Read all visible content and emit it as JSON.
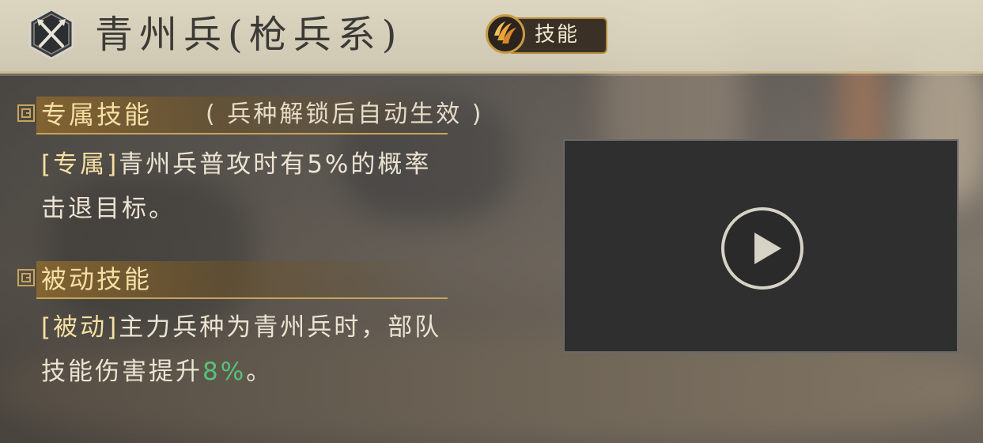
{
  "header": {
    "title": "青州兵(枪兵系)",
    "skill_tag_label": "技能",
    "unit_icon": "crossed-spears-icon",
    "skill_icon": "claw-skill-icon"
  },
  "exclusive_skill": {
    "title": "专属技能",
    "subtitle": "( 兵种解锁后自动生效 )",
    "tag": "[专属]",
    "text_line1": "青州兵普攻时有5%的概率",
    "text_line2": "击退目标。"
  },
  "passive_skill": {
    "title": "被动技能",
    "tag": "[被动]",
    "text_line1": "主力兵种为青州兵时，部队",
    "text_line2_prefix": "技能伤害提升",
    "text_highlight": "8%",
    "text_line2_suffix": "。"
  },
  "video": {
    "play_icon": "play-icon"
  },
  "colors": {
    "accent_gold": "#f6dfa3",
    "highlight_green": "#58c27a"
  }
}
